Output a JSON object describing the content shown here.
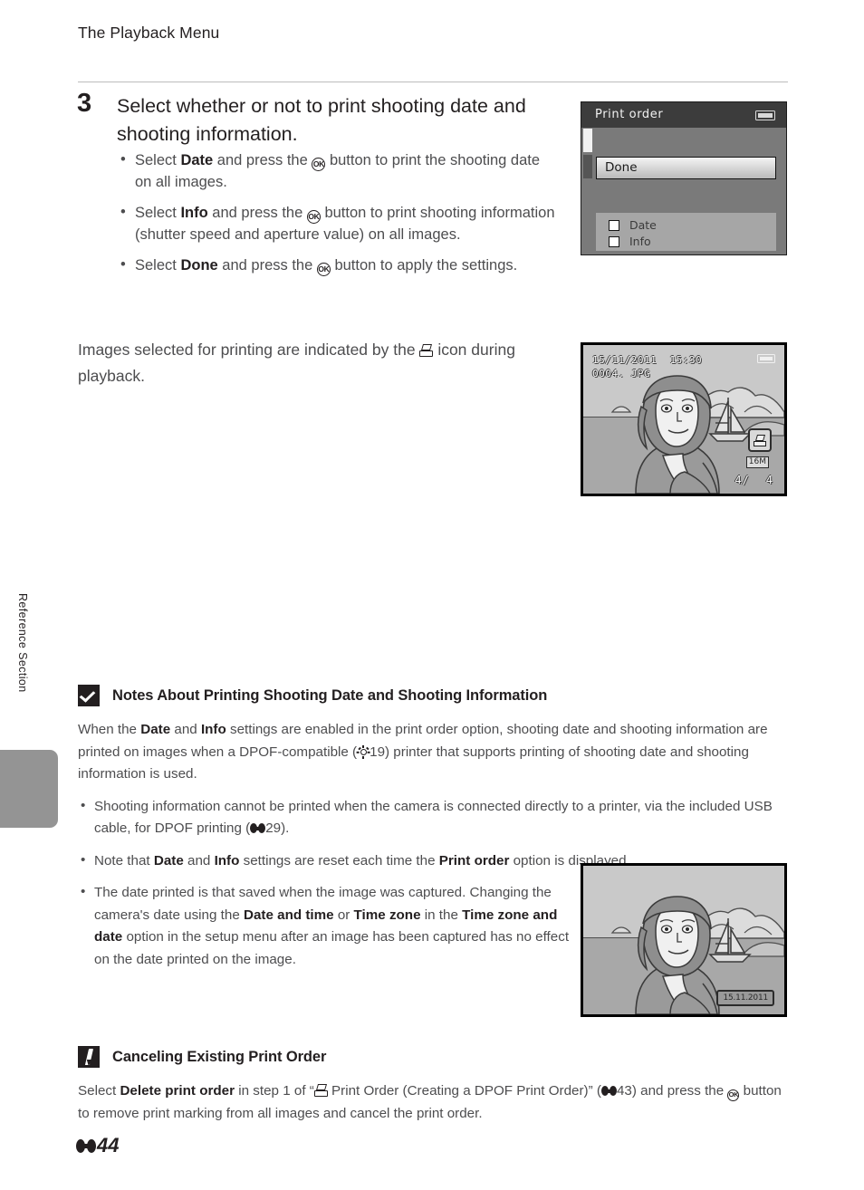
{
  "header": {
    "running_title": "The Playback Menu"
  },
  "side_tab": {
    "label": "Reference Section"
  },
  "step": {
    "number": "3",
    "title": "Select whether or not to print shooting date and shooting information.",
    "bullets": [
      {
        "pre": "Select ",
        "bold1": "Date",
        "mid": " and press the ",
        "post": " button to print the shooting date on all images."
      },
      {
        "pre": "Select ",
        "bold1": "Info",
        "mid": " and press the ",
        "post": " button to print shooting information (shutter speed and aperture value) on all images."
      },
      {
        "pre": "Select ",
        "bold1": "Done",
        "mid": " and press the ",
        "post": " button to apply the settings."
      }
    ]
  },
  "intro_paragraph": {
    "part1": "Images selected for printing are indicated by the ",
    "part2": " icon during playback."
  },
  "print_order_screen": {
    "title": "Print order",
    "done_label": "Done",
    "checkboxes": [
      {
        "label": "Date",
        "checked": false
      },
      {
        "label": "Info",
        "checked": false
      }
    ]
  },
  "playback_screen_top": {
    "date": "15/11/2011  15:30",
    "filename": "0004. JPG",
    "image_size": "16M",
    "frame_current": "4/",
    "frame_total": "4"
  },
  "playback_screen_bottom": {
    "datestamp": "15.11.2011"
  },
  "note_printing": {
    "heading": "Notes About Printing Shooting Date and Shooting Information",
    "intro": {
      "p1": "When the ",
      "b1": "Date",
      "p2": " and ",
      "b2": "Info",
      "p3": " settings are enabled in the print order option, shooting date and shooting information are printed on images when a DPOF-compatible (",
      "ref": "19",
      "p4": ") printer that supports printing of shooting date and shooting information is used."
    },
    "bullets": [
      {
        "p1": "Shooting information cannot be printed when the camera is connected directly to a printer, via the included USB cable, for DPOF printing (",
        "ref": "29",
        "p2": ")."
      },
      {
        "p1": "Note that ",
        "b1": "Date",
        "p2": " and ",
        "b2": "Info",
        "p3": " settings are reset each time the ",
        "b3": "Print order",
        "p4": " option is displayed."
      },
      {
        "p1": "The date printed is that saved when the image was captured. Changing the camera's date using the ",
        "b1": "Date and time",
        "p2": " or ",
        "b2": "Time zone",
        "p3": " in the ",
        "b3": "Time zone and date",
        "p4": " option in the setup menu after an image has been captured has no effect on the date printed on the image."
      }
    ]
  },
  "note_canceling": {
    "heading": "Canceling Existing Print Order",
    "body": {
      "p1": "Select ",
      "b1": "Delete print order",
      "p2": " in step 1 of “",
      "p3": " Print Order (Creating a DPOF Print Order)” (",
      "ref": "43",
      "p4": ") and press the ",
      "p5": " button to remove print marking from all images and cancel the print order."
    }
  },
  "footer": {
    "page_number": "44"
  }
}
